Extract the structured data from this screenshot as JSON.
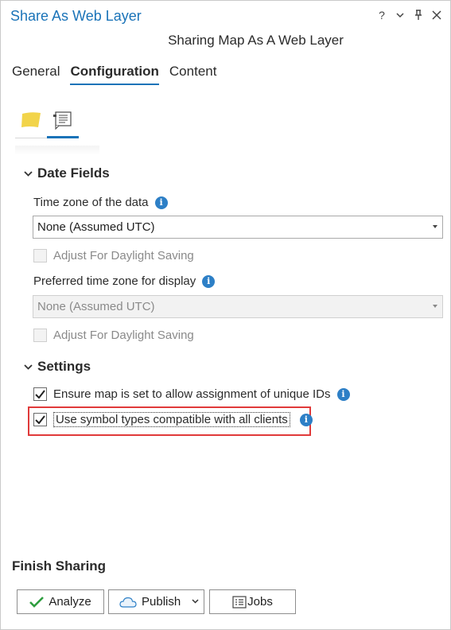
{
  "window": {
    "title": "Share As Web Layer",
    "controls": [
      "?",
      "▾",
      "⊥",
      "✕"
    ]
  },
  "subtitle": "Sharing Map As A Web Layer",
  "tabs": [
    {
      "label": "General",
      "active": false
    },
    {
      "label": "Configuration",
      "active": true
    },
    {
      "label": "Content",
      "active": false
    }
  ],
  "subtabs": [
    {
      "icon": "layer-icon",
      "active": false
    },
    {
      "icon": "configure-pane-icon",
      "active": true
    }
  ],
  "date_fields": {
    "header": "Date Fields",
    "time_zone_label": "Time zone of the data",
    "time_zone_value": "None (Assumed UTC)",
    "adjust_dst_1": {
      "label": "Adjust For Daylight Saving",
      "checked": false,
      "enabled": false
    },
    "preferred_tz_label": "Preferred time zone for display",
    "preferred_tz_value": "None (Assumed UTC)",
    "adjust_dst_2": {
      "label": "Adjust For Daylight Saving",
      "checked": false,
      "enabled": false
    }
  },
  "settings": {
    "header": "Settings",
    "unique_ids": {
      "label": "Ensure map is set to allow assignment of unique IDs",
      "checked": true
    },
    "symbol_types": {
      "label": "Use symbol types compatible with all clients",
      "checked": true
    }
  },
  "finish": {
    "header": "Finish Sharing",
    "analyze_label": "Analyze",
    "publish_label": "Publish",
    "jobs_label": "Jobs"
  },
  "colors": {
    "accent": "#1a73b8",
    "info": "#2d7fc6",
    "highlight": "#e03a3a",
    "analyze_check": "#2e9e3f",
    "layer_icon": "#f2d44a"
  }
}
